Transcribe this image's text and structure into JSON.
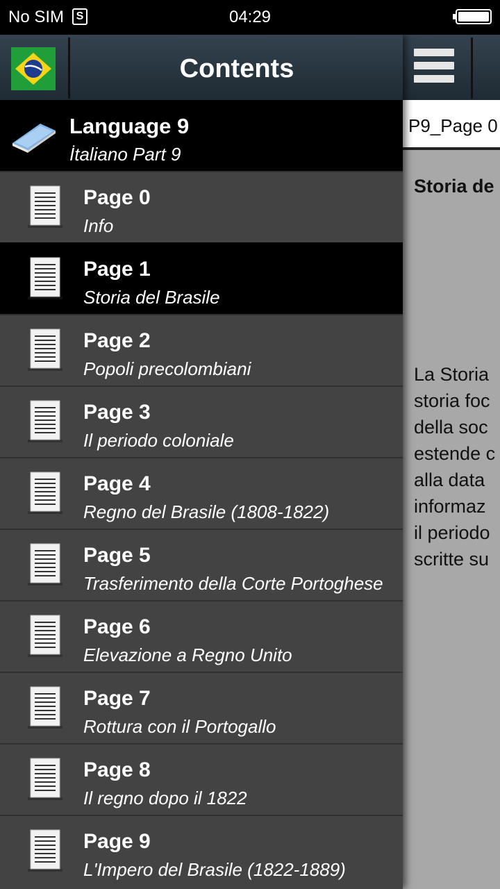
{
  "status_bar": {
    "carrier": "No SIM",
    "sim_icon": "S",
    "time": "04:29",
    "battery_level": 1.0
  },
  "drawer": {
    "title": "Contents",
    "flag_icon": "brazil-flag-icon",
    "language": {
      "title": "Language 9",
      "subtitle": "İtaliano Part 9"
    },
    "items": [
      {
        "title": "Page 0",
        "subtitle": "Info",
        "selected": false
      },
      {
        "title": "Page 1",
        "subtitle": "Storia del Brasile",
        "selected": true
      },
      {
        "title": "Page 2",
        "subtitle": "Popoli precolombiani",
        "selected": false
      },
      {
        "title": "Page 3",
        "subtitle": "Il periodo coloniale",
        "selected": false
      },
      {
        "title": "Page 4",
        "subtitle": "Regno del Brasile (1808-1822)",
        "selected": false
      },
      {
        "title": "Page 5",
        "subtitle": "Trasferimento della Corte Portoghese",
        "selected": false
      },
      {
        "title": "Page 6",
        "subtitle": "Elevazione a Regno Unito",
        "selected": false
      },
      {
        "title": "Page 7",
        "subtitle": "Rottura con il Portogallo",
        "selected": false
      },
      {
        "title": "Page 8",
        "subtitle": "Il regno dopo il 1822",
        "selected": false
      },
      {
        "title": "Page 9",
        "subtitle": "L'Impero del Brasile (1822-1889)",
        "selected": false
      }
    ]
  },
  "main": {
    "menu_icon": "hamburger-menu-icon",
    "page_field_value": "P9_Page 0",
    "heading": "Storia de",
    "body_lines": [
      "La Storia",
      "storia foc",
      "della soc",
      "estende c",
      "alla data",
      "informaz",
      "il periodo",
      "scritte su"
    ]
  },
  "colors": {
    "drawer_bg": "#434343",
    "selected_bg": "#000000",
    "toolbar_top": "#34434f",
    "main_bg": "#a8a8a8"
  }
}
